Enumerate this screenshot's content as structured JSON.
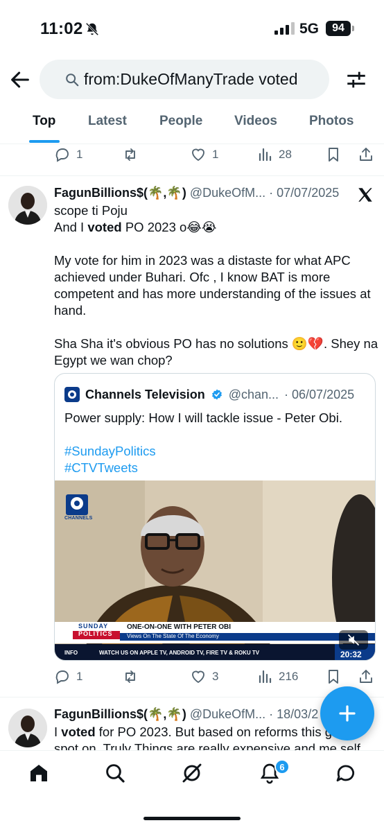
{
  "status_bar": {
    "time": "11:02",
    "network": "5G",
    "battery": "94"
  },
  "search": {
    "query": "from:DukeOfManyTrade voted"
  },
  "tabs": [
    {
      "label": "Top",
      "active": true
    },
    {
      "label": "Latest",
      "active": false
    },
    {
      "label": "People",
      "active": false
    },
    {
      "label": "Videos",
      "active": false
    },
    {
      "label": "Photos",
      "active": false
    }
  ],
  "prev_tweet_actions": {
    "replies": "1",
    "retweets": "",
    "likes": "1",
    "views": "28"
  },
  "tweet1": {
    "name": "FagunBillions$(🌴,🌴)",
    "handle": "@DukeOfM...",
    "date": "· 07/07/2025",
    "line1": "scope ti Poju",
    "line2_pre": "And I ",
    "line2_bold": "voted",
    "line2_post": " PO 2023 o😂😭",
    "para2": "My vote for him in 2023 was a distaste for what APC achieved under Buhari. Ofc , I know BAT is more competent and has more understanding of the issues at hand.",
    "para3": "Sha Sha it's obvious PO has no solutions 🙂💔. Shey na Egypt we wan chop?",
    "quote": {
      "name": "Channels Television",
      "handle": "@chan...",
      "date": "· 06/07/2025",
      "text": "Power supply: How I will tackle issue - Peter Obi.",
      "hashtag1": "#SundayPolitics",
      "hashtag2": "#CTVTweets",
      "video": {
        "channel_logo": "CHANNELS",
        "show_top": "SUNDAY",
        "show_bottom": "POLITICS",
        "headline": "ONE-ON-ONE WITH PETER OBI",
        "subheadline": "Views On The State Of The Economy",
        "ticker_label": "INFO",
        "ticker_text": "WATCH US ON APPLE TV, ANDROID TV, FIRE TV & ROKU TV",
        "clock": "20:32"
      }
    },
    "actions": {
      "replies": "1",
      "retweets": "",
      "likes": "3",
      "views": "216"
    }
  },
  "tweet2": {
    "name": "FagunBillions$(🌴,🌴)",
    "handle": "@DukeOfM...",
    "date": "· 18/03/2",
    "line1_pre": "I ",
    "line1_bold": "voted",
    "line1_post": " for PO 2023. But based on reforms this g",
    "line2": "spot on. Truly Things are really expensive and me self"
  },
  "bottom_nav": {
    "notifications_count": "6"
  },
  "colors": {
    "accent": "#1d9bf0",
    "text": "#0f1419",
    "secondary": "#536471"
  }
}
